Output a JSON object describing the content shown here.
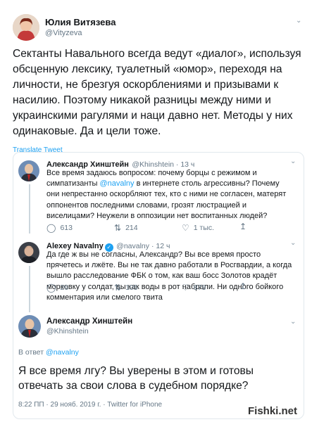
{
  "main_tweet": {
    "author_name": "Юлия Витязева",
    "author_handle": "@Vityzeva",
    "text": "Сектанты Навального всегда ведут «диалог», используя обсценную лексику, туалетный «юмор», переходя на личности, не брезгуя оскорблениями и призывами к насилию. Поэтому никакой разницы между ними и украинскими рагулями и наци давно нет. Методы у них одинаковые. Да и цели тоже.",
    "translate": "Translate Tweet"
  },
  "thread": [
    {
      "name": "Александр Хинштейн",
      "handle": "@Khinshtein · 13 ч",
      "text_before": "Все время задаюсь вопросом: почему борцы с режимом и симпатизанты ",
      "mention": "@navalny",
      "text_after": " в интернете столь агрессивны? Почему они непрестанно оскорбляют тех, кто с ними не согласен, матерят оппонентов последними словами, грозят люстрацией и виселицами? Неужели в оппозиции нет воспитанных людей?",
      "replies": "613",
      "retweets": "214",
      "likes": "1 тыс."
    },
    {
      "name": "Alexey Navalny",
      "handle": "@navalny · 12 ч",
      "text": "Да где ж вы не согласны, Александр? Вы все время просто прячетесь и лжёте. Вы не так давно работали в Росгвардии, а когда вышло расследование ФБК о том, как ваш босс Золотов крадёт морковку у солдат, вы как воды в рот набрали. Ни одного бойкого комментария или смелого твита",
      "replies": "26",
      "retweets": "105",
      "likes": "878"
    }
  ],
  "final_reply": {
    "name": "Александр Хинштейн",
    "handle": "@Khinshtein",
    "reply_prefix": "В ответ ",
    "reply_mention": "@navalny",
    "text": "Я все время лгу? Вы уверены в этом и готовы отвечать за свои слова в судебном порядке?",
    "footer": "8:22 ПП · 29 нояб. 2019 г. · Twitter for iPhone"
  },
  "watermark": "Fishki.net"
}
